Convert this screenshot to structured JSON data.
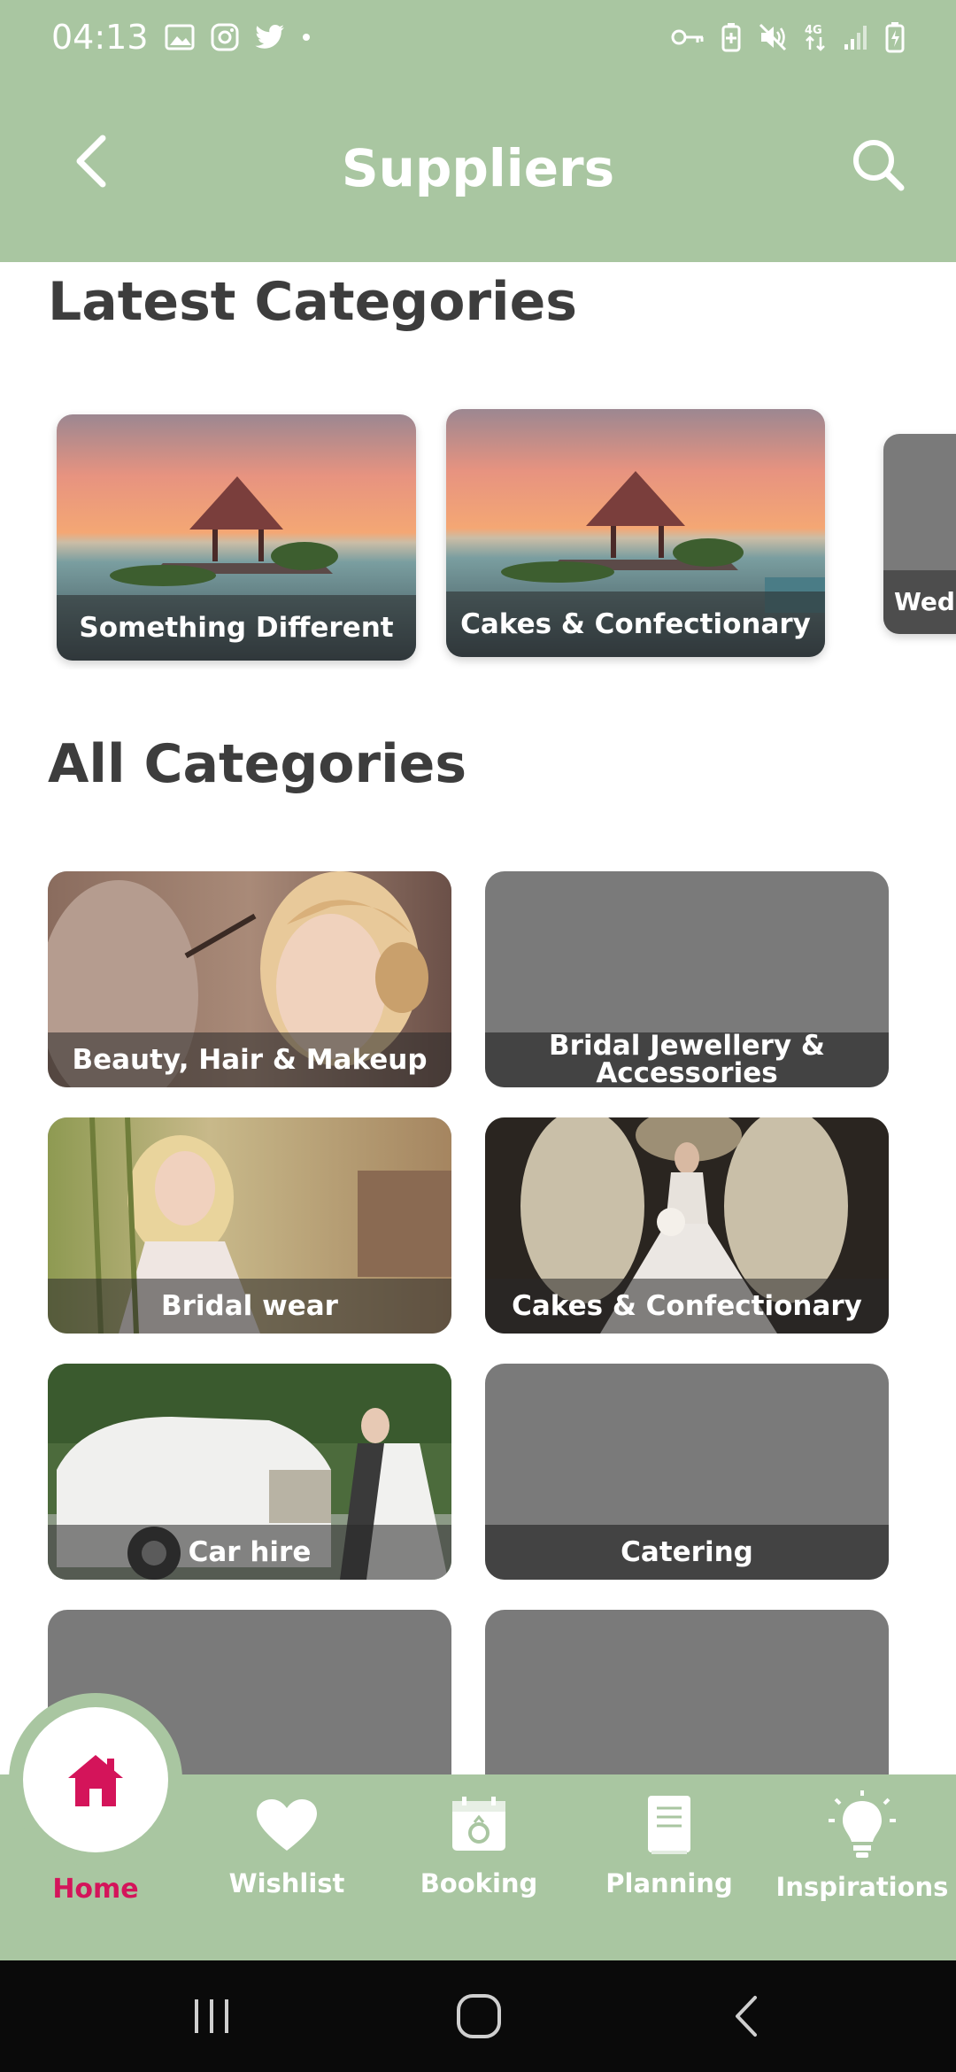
{
  "status_bar": {
    "time": "04:13"
  },
  "header": {
    "title": "Suppliers"
  },
  "latest": {
    "title": "Latest Categories",
    "cards": [
      {
        "label": "Something Different"
      },
      {
        "label": "Cakes & Confectionary"
      },
      {
        "label": "Wed"
      }
    ]
  },
  "all": {
    "title": "All Categories",
    "cards": [
      {
        "label": "Beauty, Hair & Makeup"
      },
      {
        "label": "Bridal Jewellery & Accessories"
      },
      {
        "label": "Bridal wear"
      },
      {
        "label": "Cakes & Confectionary"
      },
      {
        "label": "Car hire"
      },
      {
        "label": "Catering"
      }
    ]
  },
  "bottom_nav": {
    "items": [
      {
        "label": "Home",
        "active": true
      },
      {
        "label": "Wishlist"
      },
      {
        "label": "Booking"
      },
      {
        "label": "Planning"
      },
      {
        "label": "Inspirations"
      }
    ]
  },
  "colors": {
    "accent": "#a9c6a1",
    "active": "#d4145a",
    "heading": "#3d3d3d",
    "placeholder": "#7a7a7a"
  }
}
